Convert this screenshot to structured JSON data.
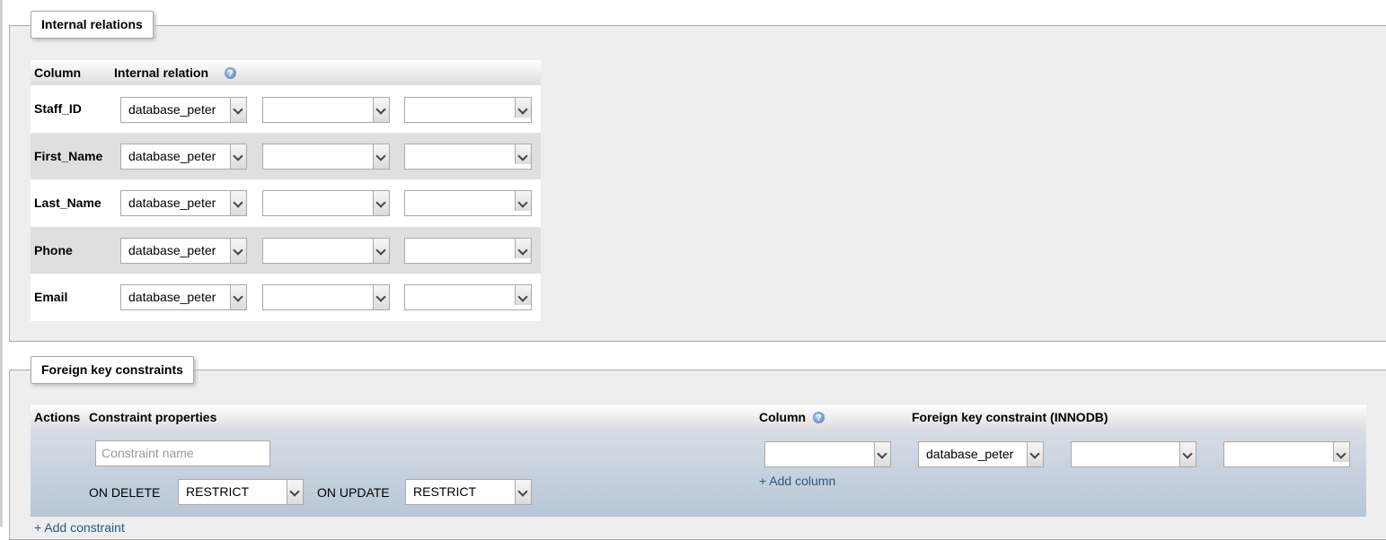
{
  "internal_relations": {
    "legend": "Internal relations",
    "headers": {
      "column": "Column",
      "relation": "Internal relation"
    },
    "rows": [
      {
        "column": "Staff_ID",
        "db": "database_peter",
        "table": "",
        "field": ""
      },
      {
        "column": "First_Name",
        "db": "database_peter",
        "table": "",
        "field": ""
      },
      {
        "column": "Last_Name",
        "db": "database_peter",
        "table": "",
        "field": ""
      },
      {
        "column": "Phone",
        "db": "database_peter",
        "table": "",
        "field": ""
      },
      {
        "column": "Email",
        "db": "database_peter",
        "table": "",
        "field": ""
      }
    ]
  },
  "foreign_keys": {
    "legend": "Foreign key constraints",
    "headers": {
      "actions": "Actions",
      "properties": "Constraint properties",
      "column": "Column",
      "fk": "Foreign key constraint (INNODB)"
    },
    "constraint_name_placeholder": "Constraint name",
    "on_delete_label": "ON DELETE",
    "on_delete_value": "RESTRICT",
    "on_update_label": "ON UPDATE",
    "on_update_value": "RESTRICT",
    "column_value": "",
    "ref_db": "database_peter",
    "ref_table": "",
    "ref_column": "",
    "add_column": "+ Add column",
    "add_constraint": "+ Add constraint"
  },
  "icons": {
    "help": "help-icon",
    "dropdown": "chevron-down-icon"
  }
}
